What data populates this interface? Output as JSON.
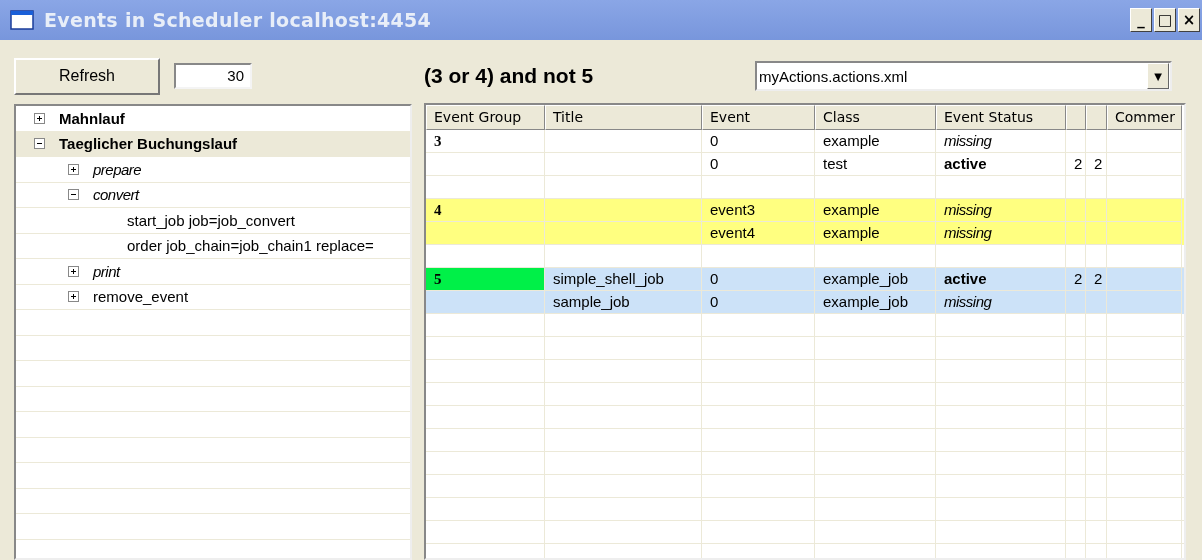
{
  "window": {
    "title": "Events in Scheduler localhost:4454",
    "controls": [
      "_",
      "□",
      "×"
    ]
  },
  "toolbar": {
    "refresh_button": "Refresh",
    "interval": "30",
    "expression": "(3 or 4) and not 5",
    "file_dropdown": "myActions.actions.xml",
    "dropdown_arrow": "▼"
  },
  "tree": [
    {
      "label": "Mahnlauf",
      "kind": "group",
      "expanded": false,
      "selected": false
    },
    {
      "label": "Taeglicher Buchungslauf",
      "kind": "group",
      "expanded": true,
      "selected": true,
      "children": [
        {
          "label": "prepare",
          "kind": "chain",
          "expanded": false,
          "selected": false
        },
        {
          "label": "convert",
          "kind": "chain",
          "expanded": true,
          "selected": false,
          "children": [
            {
              "label": "start_job job=job_convert",
              "kind": "command",
              "selected": false
            },
            {
              "label": "order job_chain=job_chain1 replace=",
              "kind": "command",
              "selected": false
            }
          ]
        },
        {
          "label": "print",
          "kind": "chain",
          "expanded": false,
          "selected": false
        },
        {
          "label": "remove_event",
          "kind": "command",
          "expanded": false,
          "selected": false
        }
      ]
    }
  ],
  "table": {
    "columns": [
      "Event Group",
      "Title",
      "Event",
      "Class",
      "Event Status",
      "",
      "",
      "Commer"
    ],
    "rows": [
      {
        "kind": "event",
        "color": "#ffffff",
        "group": {
          "text": "3"
        },
        "event": "0",
        "class": "example",
        "status": "missing",
        "active": false
      },
      {
        "kind": "event",
        "color": "#ffffff",
        "event": "0",
        "class": "test",
        "status": "active",
        "active": true,
        "col_6": "2",
        "col_7": "2"
      },
      {
        "kind": "blank"
      },
      {
        "kind": "event",
        "color": "#ffff80",
        "group": {
          "text": "4"
        },
        "event": "event3",
        "class": "example",
        "status": "missing",
        "active": false
      },
      {
        "kind": "event",
        "color": "#ffff80",
        "event": "event4",
        "class": "example",
        "status": "missing",
        "active": false
      },
      {
        "kind": "blank"
      },
      {
        "kind": "event",
        "color": "#cce2f8",
        "group": {
          "text": "5",
          "color": "#00f048"
        },
        "title": "simple_shell_job",
        "event": "0",
        "class": "example_job",
        "status": "active",
        "active": true,
        "col_6": "2",
        "col_7": "2"
      },
      {
        "kind": "event",
        "color": "#cce2f8",
        "title": "sample_job",
        "event": "0",
        "class": "example_job",
        "status": "missing",
        "active": false
      }
    ]
  }
}
